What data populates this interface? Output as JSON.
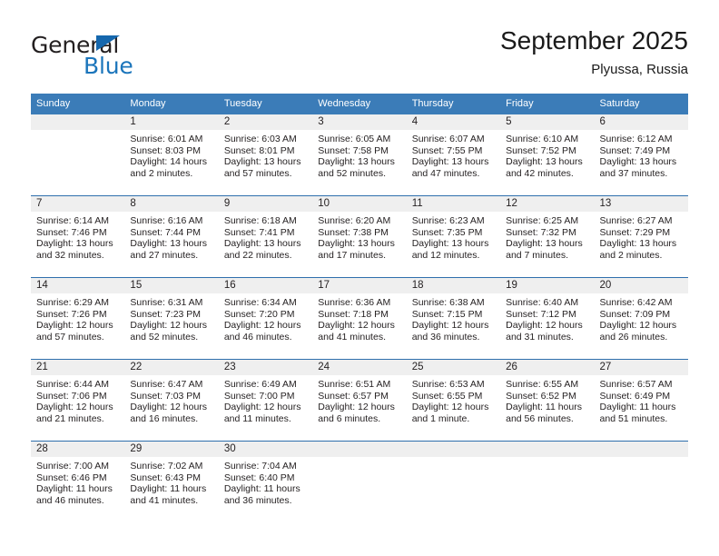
{
  "brand": {
    "word_top": "General",
    "word_bottom": "Blue",
    "triangle_color": "#1567ad",
    "blue_color": "#1b75bb"
  },
  "header": {
    "title": "September 2025",
    "subtitle": "Plyussa, Russia",
    "header_bg": "#3b7cb8",
    "row_separator": "#2f6fad",
    "daynum_band_bg": "#efefef"
  },
  "weekdays": [
    "Sunday",
    "Monday",
    "Tuesday",
    "Wednesday",
    "Thursday",
    "Friday",
    "Saturday"
  ],
  "labels": {
    "sunrise_prefix": "Sunrise:",
    "sunset_prefix": "Sunset:",
    "daylight_prefix": "Daylight:"
  },
  "weeks": [
    [
      {
        "day": "",
        "l1": "",
        "l2": "",
        "l3": "",
        "l4": ""
      },
      {
        "day": "1",
        "l1": "Sunrise: 6:01 AM",
        "l2": "Sunset: 8:03 PM",
        "l3": "Daylight: 14 hours",
        "l4": "and 2 minutes."
      },
      {
        "day": "2",
        "l1": "Sunrise: 6:03 AM",
        "l2": "Sunset: 8:01 PM",
        "l3": "Daylight: 13 hours",
        "l4": "and 57 minutes."
      },
      {
        "day": "3",
        "l1": "Sunrise: 6:05 AM",
        "l2": "Sunset: 7:58 PM",
        "l3": "Daylight: 13 hours",
        "l4": "and 52 minutes."
      },
      {
        "day": "4",
        "l1": "Sunrise: 6:07 AM",
        "l2": "Sunset: 7:55 PM",
        "l3": "Daylight: 13 hours",
        "l4": "and 47 minutes."
      },
      {
        "day": "5",
        "l1": "Sunrise: 6:10 AM",
        "l2": "Sunset: 7:52 PM",
        "l3": "Daylight: 13 hours",
        "l4": "and 42 minutes."
      },
      {
        "day": "6",
        "l1": "Sunrise: 6:12 AM",
        "l2": "Sunset: 7:49 PM",
        "l3": "Daylight: 13 hours",
        "l4": "and 37 minutes."
      }
    ],
    [
      {
        "day": "7",
        "l1": "Sunrise: 6:14 AM",
        "l2": "Sunset: 7:46 PM",
        "l3": "Daylight: 13 hours",
        "l4": "and 32 minutes."
      },
      {
        "day": "8",
        "l1": "Sunrise: 6:16 AM",
        "l2": "Sunset: 7:44 PM",
        "l3": "Daylight: 13 hours",
        "l4": "and 27 minutes."
      },
      {
        "day": "9",
        "l1": "Sunrise: 6:18 AM",
        "l2": "Sunset: 7:41 PM",
        "l3": "Daylight: 13 hours",
        "l4": "and 22 minutes."
      },
      {
        "day": "10",
        "l1": "Sunrise: 6:20 AM",
        "l2": "Sunset: 7:38 PM",
        "l3": "Daylight: 13 hours",
        "l4": "and 17 minutes."
      },
      {
        "day": "11",
        "l1": "Sunrise: 6:23 AM",
        "l2": "Sunset: 7:35 PM",
        "l3": "Daylight: 13 hours",
        "l4": "and 12 minutes."
      },
      {
        "day": "12",
        "l1": "Sunrise: 6:25 AM",
        "l2": "Sunset: 7:32 PM",
        "l3": "Daylight: 13 hours",
        "l4": "and 7 minutes."
      },
      {
        "day": "13",
        "l1": "Sunrise: 6:27 AM",
        "l2": "Sunset: 7:29 PM",
        "l3": "Daylight: 13 hours",
        "l4": "and 2 minutes."
      }
    ],
    [
      {
        "day": "14",
        "l1": "Sunrise: 6:29 AM",
        "l2": "Sunset: 7:26 PM",
        "l3": "Daylight: 12 hours",
        "l4": "and 57 minutes."
      },
      {
        "day": "15",
        "l1": "Sunrise: 6:31 AM",
        "l2": "Sunset: 7:23 PM",
        "l3": "Daylight: 12 hours",
        "l4": "and 52 minutes."
      },
      {
        "day": "16",
        "l1": "Sunrise: 6:34 AM",
        "l2": "Sunset: 7:20 PM",
        "l3": "Daylight: 12 hours",
        "l4": "and 46 minutes."
      },
      {
        "day": "17",
        "l1": "Sunrise: 6:36 AM",
        "l2": "Sunset: 7:18 PM",
        "l3": "Daylight: 12 hours",
        "l4": "and 41 minutes."
      },
      {
        "day": "18",
        "l1": "Sunrise: 6:38 AM",
        "l2": "Sunset: 7:15 PM",
        "l3": "Daylight: 12 hours",
        "l4": "and 36 minutes."
      },
      {
        "day": "19",
        "l1": "Sunrise: 6:40 AM",
        "l2": "Sunset: 7:12 PM",
        "l3": "Daylight: 12 hours",
        "l4": "and 31 minutes."
      },
      {
        "day": "20",
        "l1": "Sunrise: 6:42 AM",
        "l2": "Sunset: 7:09 PM",
        "l3": "Daylight: 12 hours",
        "l4": "and 26 minutes."
      }
    ],
    [
      {
        "day": "21",
        "l1": "Sunrise: 6:44 AM",
        "l2": "Sunset: 7:06 PM",
        "l3": "Daylight: 12 hours",
        "l4": "and 21 minutes."
      },
      {
        "day": "22",
        "l1": "Sunrise: 6:47 AM",
        "l2": "Sunset: 7:03 PM",
        "l3": "Daylight: 12 hours",
        "l4": "and 16 minutes."
      },
      {
        "day": "23",
        "l1": "Sunrise: 6:49 AM",
        "l2": "Sunset: 7:00 PM",
        "l3": "Daylight: 12 hours",
        "l4": "and 11 minutes."
      },
      {
        "day": "24",
        "l1": "Sunrise: 6:51 AM",
        "l2": "Sunset: 6:57 PM",
        "l3": "Daylight: 12 hours",
        "l4": "and 6 minutes."
      },
      {
        "day": "25",
        "l1": "Sunrise: 6:53 AM",
        "l2": "Sunset: 6:55 PM",
        "l3": "Daylight: 12 hours",
        "l4": "and 1 minute."
      },
      {
        "day": "26",
        "l1": "Sunrise: 6:55 AM",
        "l2": "Sunset: 6:52 PM",
        "l3": "Daylight: 11 hours",
        "l4": "and 56 minutes."
      },
      {
        "day": "27",
        "l1": "Sunrise: 6:57 AM",
        "l2": "Sunset: 6:49 PM",
        "l3": "Daylight: 11 hours",
        "l4": "and 51 minutes."
      }
    ],
    [
      {
        "day": "28",
        "l1": "Sunrise: 7:00 AM",
        "l2": "Sunset: 6:46 PM",
        "l3": "Daylight: 11 hours",
        "l4": "and 46 minutes."
      },
      {
        "day": "29",
        "l1": "Sunrise: 7:02 AM",
        "l2": "Sunset: 6:43 PM",
        "l3": "Daylight: 11 hours",
        "l4": "and 41 minutes."
      },
      {
        "day": "30",
        "l1": "Sunrise: 7:04 AM",
        "l2": "Sunset: 6:40 PM",
        "l3": "Daylight: 11 hours",
        "l4": "and 36 minutes."
      },
      {
        "day": "",
        "l1": "",
        "l2": "",
        "l3": "",
        "l4": ""
      },
      {
        "day": "",
        "l1": "",
        "l2": "",
        "l3": "",
        "l4": ""
      },
      {
        "day": "",
        "l1": "",
        "l2": "",
        "l3": "",
        "l4": ""
      },
      {
        "day": "",
        "l1": "",
        "l2": "",
        "l3": "",
        "l4": ""
      }
    ]
  ]
}
